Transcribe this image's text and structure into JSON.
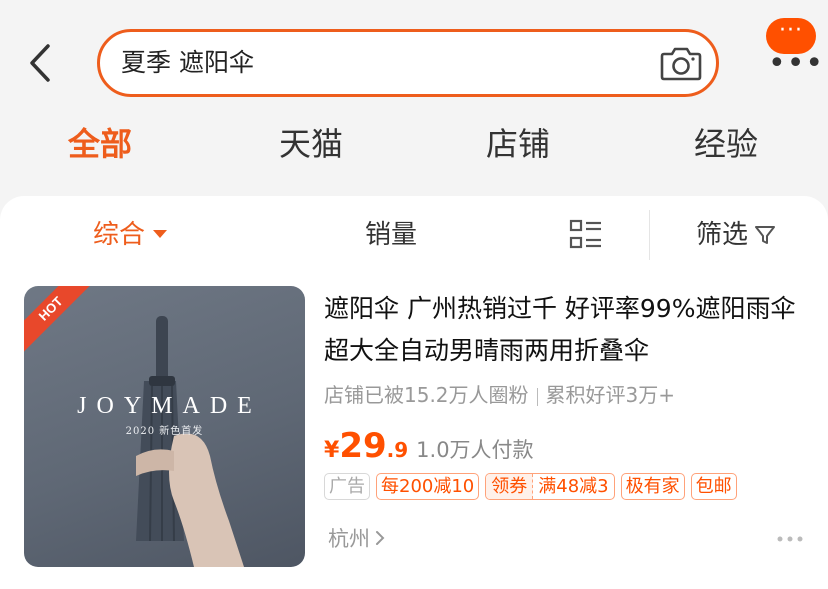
{
  "header": {
    "search_query": "夏季 遮阳伞",
    "more_bubble": "···",
    "more_dots": "•••"
  },
  "tabs": [
    {
      "label": "全部",
      "active": true
    },
    {
      "label": "天猫",
      "active": false
    },
    {
      "label": "店铺",
      "active": false
    },
    {
      "label": "经验",
      "active": false
    }
  ],
  "sort": {
    "comprehensive": "综合",
    "sales": "销量",
    "filter": "筛选"
  },
  "product": {
    "badge": "HOT",
    "image_brand": "JOYMADE",
    "image_subtitle": "2020 新色首发",
    "title": "遮阳伞 广州热销过千 好评率99%遮阳雨伞超大全自动男晴雨两用折叠伞",
    "shop_followers": "店铺已被15.2万人圈粉",
    "reviews": "累积好评3万+",
    "price_symbol": "¥",
    "price_int": "29",
    "price_dec": ".9",
    "paid_count": "1.0万人付款",
    "tags": {
      "ad": "广告",
      "discount": "每200减10",
      "coupon_label": "领券",
      "coupon_value": "满48减3",
      "store_type": "极有家",
      "shipping": "包邮"
    },
    "location": "杭州"
  },
  "colors": {
    "accent": "#ff5000",
    "accent_border": "#ee5d1c",
    "background": "#f4f4f4"
  }
}
